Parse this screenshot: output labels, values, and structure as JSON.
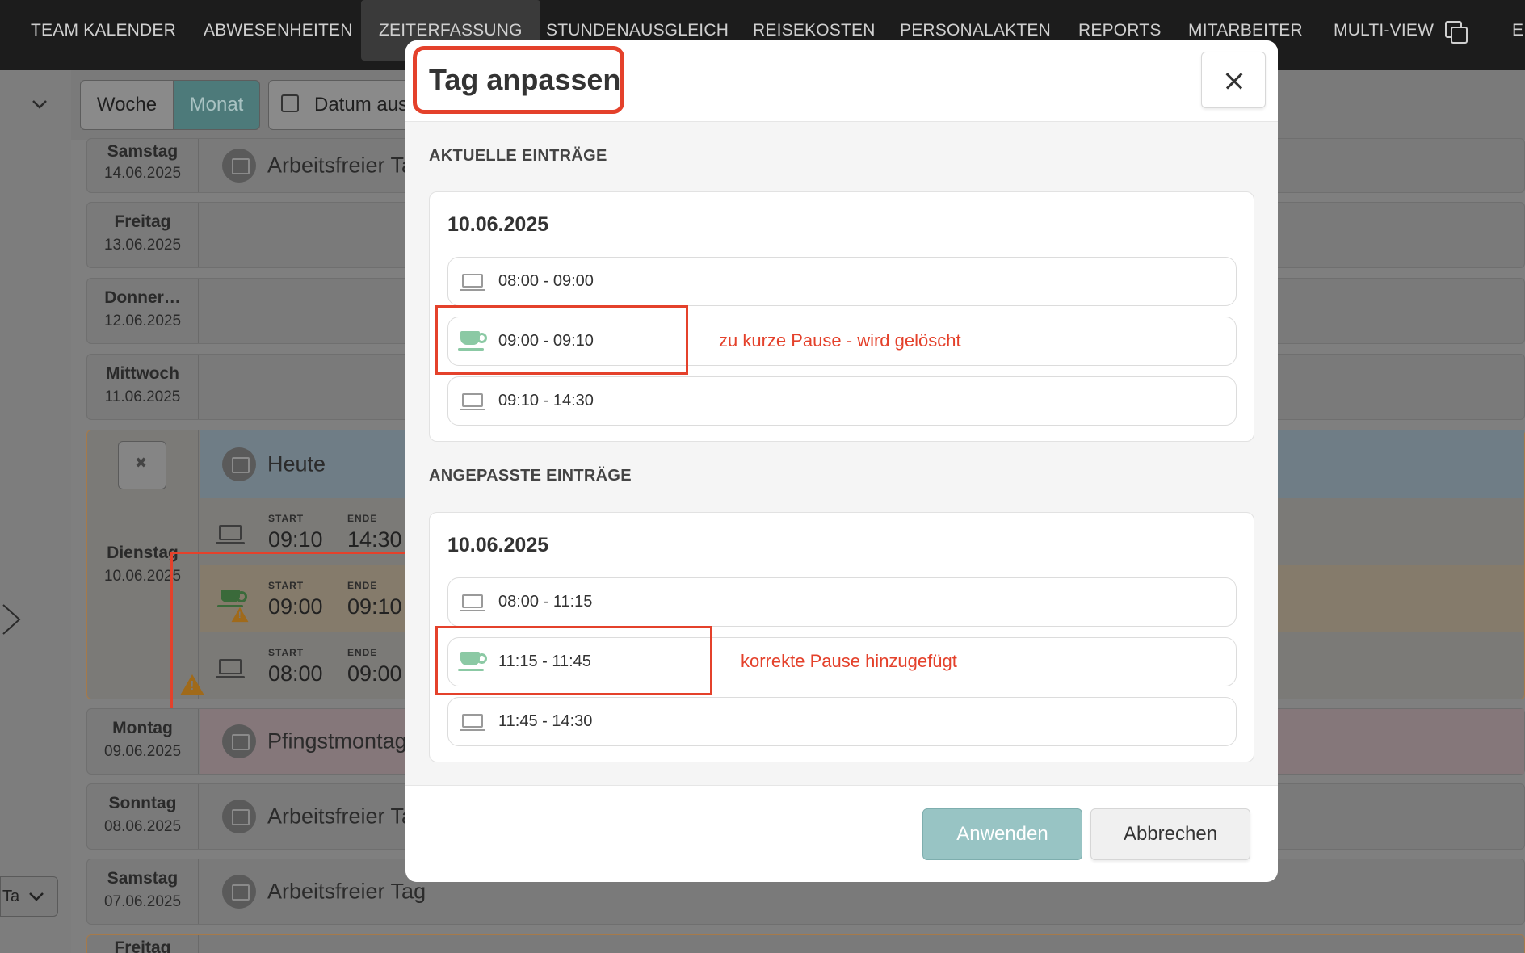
{
  "nav": {
    "items": [
      {
        "label": "TEAM KALENDER"
      },
      {
        "label": "ABWESENHEITEN"
      },
      {
        "label": "ZEITERFASSUNG",
        "active": true
      },
      {
        "label": "STUNDENAUSGLEICH"
      },
      {
        "label": "REISEKOSTEN"
      },
      {
        "label": "PERSONALAKTEN"
      },
      {
        "label": "REPORTS"
      },
      {
        "label": "MITARBEITER"
      },
      {
        "label": "MULTI-VIEW"
      },
      {
        "label": "E"
      }
    ]
  },
  "toolbar": {
    "woche": "Woche",
    "monat": "Monat",
    "datum": "Datum aus"
  },
  "days": [
    {
      "name": "Samstag",
      "date": "14.06.2025",
      "text": "Arbeitsfreier Ta"
    },
    {
      "name": "Freitag",
      "date": "13.06.2025",
      "text": ""
    },
    {
      "name": "Donner…",
      "date": "12.06.2025",
      "text": ""
    },
    {
      "name": "Mittwoch",
      "date": "11.06.2025",
      "text": ""
    },
    {
      "name": "Montag",
      "date": "09.06.2025",
      "text": "Pfingstmontag"
    },
    {
      "name": "Sonntag",
      "date": "08.06.2025",
      "text": "Arbeitsfreier Ta"
    },
    {
      "name": "Samstag",
      "date": "07.06.2025",
      "text": "Arbeitsfreier Tag"
    },
    {
      "name": "Freitag",
      "date": "",
      "text": ""
    }
  ],
  "today": {
    "name": "Dienstag",
    "date": "10.06.2025",
    "label": "Heute",
    "start_label": "START",
    "end_label": "ENDE",
    "entries": [
      {
        "start": "09:10",
        "end": "14:30",
        "type": "work"
      },
      {
        "start": "09:00",
        "end": "09:10",
        "type": "pause"
      },
      {
        "start": "08:00",
        "end": "09:00",
        "type": "work"
      }
    ]
  },
  "tag_select": "Ta",
  "colors": {
    "accent": "#98c4c4",
    "highlight": "#e4412b",
    "pause": "#8bc9a4"
  },
  "modal": {
    "title": "Tag anpassen",
    "current_heading": "AKTUELLE EINTRÄGE",
    "adjusted_heading": "ANGEPASSTE EINTRÄGE",
    "current": {
      "date": "10.06.2025",
      "entries": [
        {
          "time": "08:00 - 09:00",
          "type": "work",
          "note": ""
        },
        {
          "time": "09:00 - 09:10",
          "type": "pause",
          "note": "zu kurze Pause - wird gelöscht"
        },
        {
          "time": "09:10 - 14:30",
          "type": "work",
          "note": ""
        }
      ]
    },
    "adjusted": {
      "date": "10.06.2025",
      "entries": [
        {
          "time": "08:00 - 11:15",
          "type": "work",
          "note": ""
        },
        {
          "time": "11:15 - 11:45",
          "type": "pause",
          "note": "korrekte Pause hinzugefügt"
        },
        {
          "time": "11:45 - 14:30",
          "type": "work",
          "note": ""
        }
      ]
    },
    "apply_label": "Anwenden",
    "cancel_label": "Abbrechen"
  }
}
